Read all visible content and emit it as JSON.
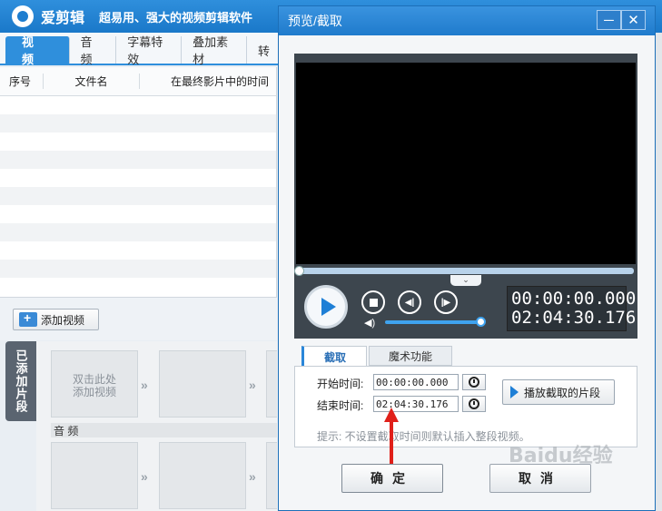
{
  "app": {
    "name": "爱剪辑",
    "slogan": "超易用、强大的视频剪辑软件",
    "tabs": [
      "视 频",
      "音 频",
      "字幕特效",
      "叠加素材",
      "转"
    ]
  },
  "clip_table": {
    "columns": [
      "序号",
      "文件名",
      "在最终影片中的时间"
    ]
  },
  "add_video_label": "添加视频",
  "side_tab_label": "已添加片段",
  "timeline": {
    "slot_hint": "双击此处\n添加视频",
    "audio_label": "音 频"
  },
  "dialog": {
    "title": "预览/截取",
    "minimize_glyph": "─",
    "close_glyph": "✕",
    "timecode_current": "00:00:00.000",
    "timecode_total": "02:04:30.176",
    "tabs": [
      "截取",
      "魔术功能"
    ],
    "start_label": "开始时间:",
    "start_value": "00:00:00.000",
    "end_label": "结束时间:",
    "end_value": "02:04:30.176",
    "play_segment_label": "播放截取的片段",
    "hint": "提示: 不设置截取时间则默认插入整段视频。",
    "ok_label": "确定",
    "cancel_label": "取消"
  },
  "watermark": "Baidu经验",
  "colors": {
    "accent": "#1f7bcc",
    "annotation_arrow": "#e0201a"
  },
  "icons": [
    "app-logo-icon",
    "film-add-icon",
    "minimize-icon",
    "close-icon",
    "play-icon",
    "stop-icon",
    "previous-frame-icon",
    "next-frame-icon",
    "volume-icon",
    "clock-icon",
    "collapse-icon"
  ]
}
